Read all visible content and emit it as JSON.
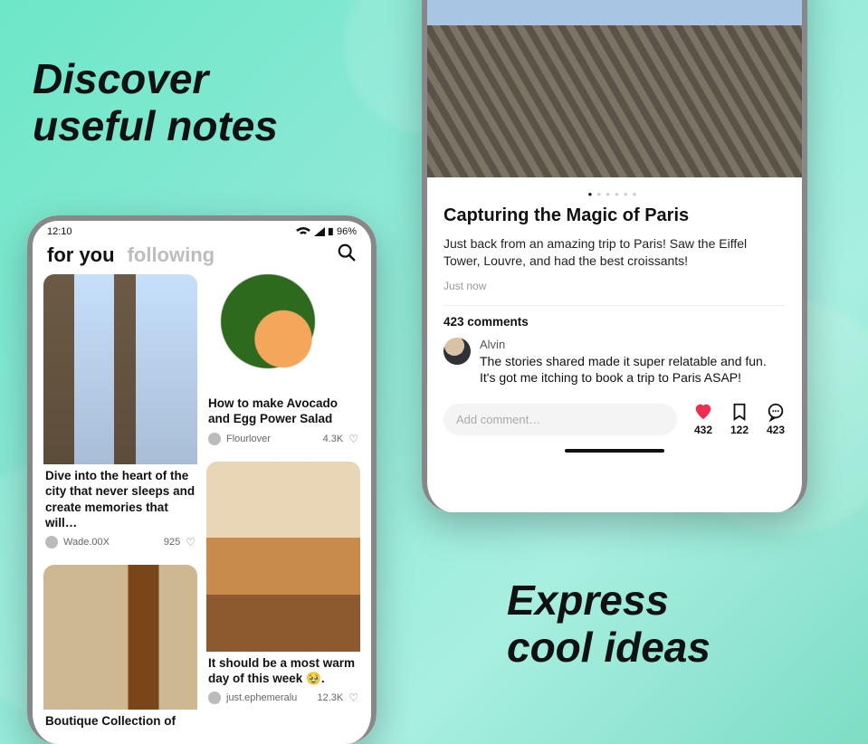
{
  "headlines": {
    "discover_line1": "Discover",
    "discover_line2": "useful notes",
    "express_line1": "Express",
    "express_line2": "cool ideas"
  },
  "statusbar": {
    "time": "12:10",
    "battery": "96%"
  },
  "tabs": {
    "for_you": "for you",
    "following": "following"
  },
  "feed": {
    "card_nyc": {
      "title": "Dive into the heart of the city that never sleeps and create memories that will…",
      "author": "Wade.00X",
      "likes": "925"
    },
    "card_boots": {
      "title": "Boutique Collection of"
    },
    "card_salad": {
      "title": "How to make Avocado and Egg Power Salad",
      "author": "Flourlover",
      "likes": "4.3K"
    },
    "card_interior": {
      "title": "It should be a most warm day of this week 🥹.",
      "author": "just.ephemeralu",
      "likes": "12.3K"
    }
  },
  "post": {
    "title": "Capturing the Magic of Paris",
    "body": "Just back from an amazing trip to Paris! Saw the Eiffel Tower, Louvre, and had the best croissants!",
    "time": "Just now",
    "comments_count": "423 comments",
    "comment1": {
      "name": "Alvin",
      "body": "The stories shared made it super relatable and fun. It's got me itching to book a trip to Paris ASAP!"
    },
    "add_comment_placeholder": "Add comment…",
    "likes": "432",
    "saves": "122",
    "comments": "423"
  }
}
